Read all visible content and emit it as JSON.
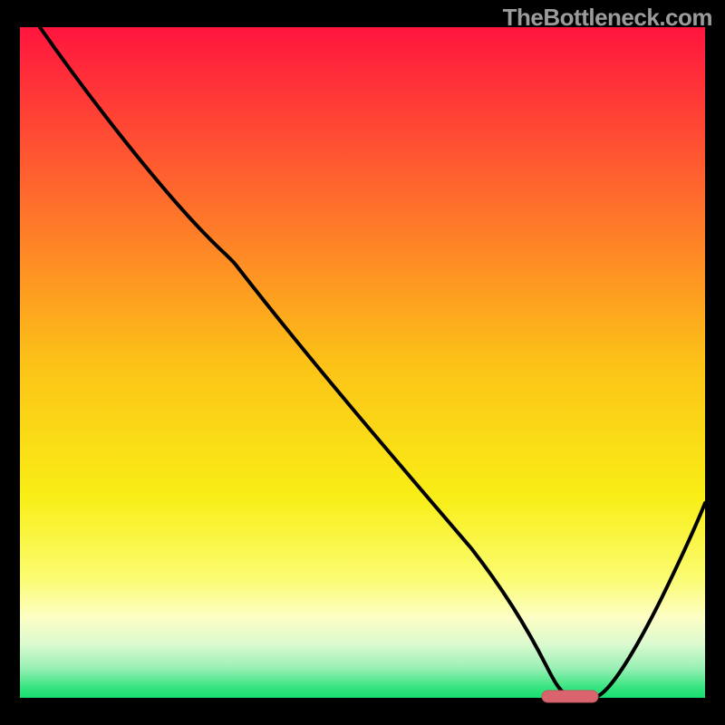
{
  "watermark": "TheBottleneck.com",
  "colors": {
    "frame": "#000000",
    "curve": "#000000",
    "marker_fill": "#D9646E",
    "marker_stroke": "#C15862"
  },
  "chart_data": {
    "type": "line",
    "title": "",
    "xlabel": "",
    "ylabel": "",
    "xlim": [
      0,
      100
    ],
    "ylim": [
      0,
      100
    ],
    "x": [
      3,
      10,
      20,
      30,
      40,
      50,
      60,
      67,
      72,
      76,
      80,
      85,
      90,
      95,
      99
    ],
    "values": [
      100,
      90,
      78,
      70,
      59,
      47,
      35,
      22,
      12,
      4,
      0,
      7,
      15,
      24,
      32
    ],
    "optimum_marker": {
      "x_center": 78,
      "x_halfwidth": 3,
      "y": 0
    },
    "background_gradient": {
      "stops": [
        {
          "offset": 0.0,
          "color": "#FF153E"
        },
        {
          "offset": 0.25,
          "color": "#FF6A2D"
        },
        {
          "offset": 0.5,
          "color": "#FCC217"
        },
        {
          "offset": 0.7,
          "color": "#F9EE16"
        },
        {
          "offset": 0.82,
          "color": "#FBFC6F"
        },
        {
          "offset": 0.88,
          "color": "#FDFEC4"
        },
        {
          "offset": 0.92,
          "color": "#DBFACF"
        },
        {
          "offset": 0.955,
          "color": "#9BF0B6"
        },
        {
          "offset": 0.985,
          "color": "#36E47F"
        },
        {
          "offset": 1.0,
          "color": "#18DD70"
        }
      ]
    }
  }
}
